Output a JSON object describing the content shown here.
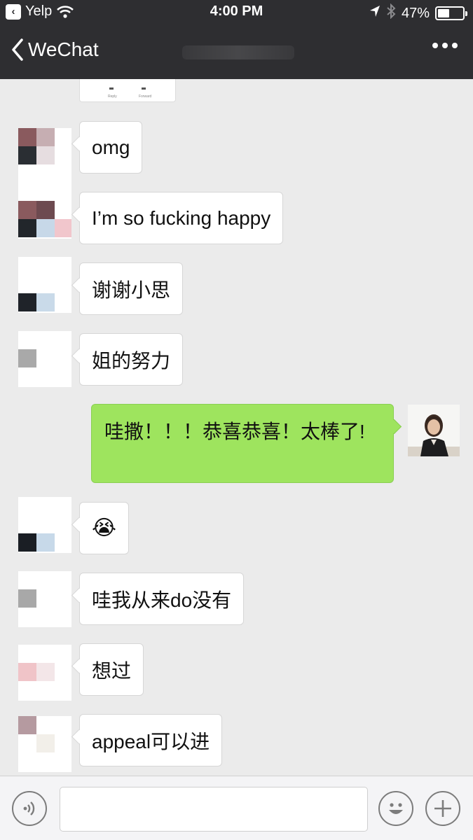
{
  "status_bar": {
    "back_app": "Yelp",
    "time": "4:00 PM",
    "battery_percent": "47%",
    "battery_level": 0.47,
    "icons": [
      "back-app-icon",
      "wifi-icon",
      "location-arrow-icon",
      "bluetooth-icon",
      "battery-icon"
    ]
  },
  "nav": {
    "back_label": "WeChat",
    "icons": [
      "back-chevron-icon",
      "more-icon"
    ]
  },
  "messages": [
    {
      "from": "other",
      "text": "omg"
    },
    {
      "from": "other",
      "text": "I’m so fucking happy"
    },
    {
      "from": "other",
      "text": "谢谢小思"
    },
    {
      "from": "other",
      "text": "姐的努力"
    },
    {
      "from": "me",
      "text": "哇撒！！！恭喜恭喜！太棒了!"
    },
    {
      "from": "other",
      "text": "😭"
    },
    {
      "from": "other",
      "text": "哇我从来do没有"
    },
    {
      "from": "other",
      "text": "想过"
    },
    {
      "from": "other",
      "text": "appeal可以进"
    }
  ],
  "input_bar": {
    "text_value": "",
    "icons": [
      "voice-icon",
      "emoji-icon",
      "plus-icon"
    ]
  },
  "colors": {
    "header_bg": "#2e2e31",
    "chat_bg": "#ebebeb",
    "my_bubble": "#9ee45e",
    "their_bubble": "#ffffff"
  }
}
